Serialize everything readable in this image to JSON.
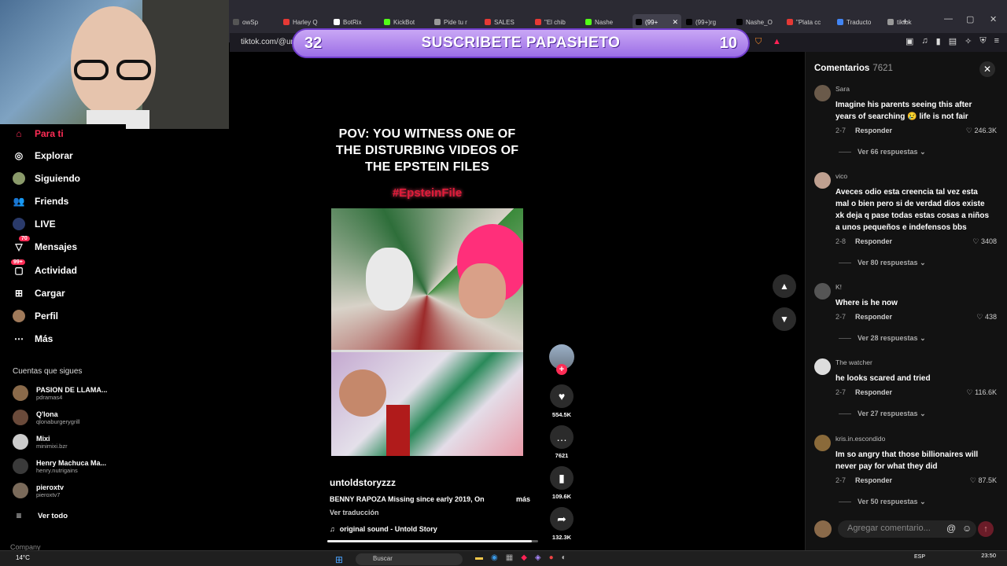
{
  "browser": {
    "tabs": [
      {
        "label": "owSp",
        "color": "#555"
      },
      {
        "label": "Harley Q",
        "color": "#e53935"
      },
      {
        "label": "BotRix",
        "color": "#ffffff"
      },
      {
        "label": "KickBot",
        "color": "#53fc18"
      },
      {
        "label": "Pide tu r",
        "color": "#999"
      },
      {
        "label": "SALES",
        "color": "#e53935"
      },
      {
        "label": "\"El chib",
        "color": "#e53935"
      },
      {
        "label": "Nashe",
        "color": "#53fc18"
      },
      {
        "label": "(99+",
        "color": "#000"
      },
      {
        "label": "(99+)rg",
        "color": "#000"
      },
      {
        "label": "Nashe_O",
        "color": "#000"
      },
      {
        "label": "\"Plata cc",
        "color": "#e53935"
      },
      {
        "label": "Traducto",
        "color": "#4285f4"
      },
      {
        "label": "tiktok",
        "color": "#999"
      }
    ],
    "active_tab_index": 8,
    "url": "tiktok.com/@ur"
  },
  "banner": {
    "left_number": "32",
    "text": "SUSCRIBETE PAPASHETO",
    "right_number": "10"
  },
  "leftnav": {
    "items": [
      {
        "label": "Para ti",
        "icon": "home-icon",
        "active": true
      },
      {
        "label": "Explorar",
        "icon": "compass-icon"
      },
      {
        "label": "Siguiendo",
        "icon": "following-avatar-icon"
      },
      {
        "label": "Friends",
        "icon": "friends-icon"
      },
      {
        "label": "LIVE",
        "icon": "live-icon"
      },
      {
        "label": "Mensajes",
        "icon": "messages-icon",
        "badge": "70"
      },
      {
        "label": "Actividad",
        "icon": "activity-icon",
        "badge": "99+"
      },
      {
        "label": "Cargar",
        "icon": "upload-icon"
      },
      {
        "label": "Perfil",
        "icon": "profile-icon"
      },
      {
        "label": "Más",
        "icon": "more-icon"
      }
    ],
    "following_title": "Cuentas que sigues",
    "following": [
      {
        "name": "PASION DE LLAMA...",
        "handle": "pdramas4"
      },
      {
        "name": "Q'lona",
        "handle": "qlonaburgerygrill"
      },
      {
        "name": "Mixi",
        "handle": "minimixi.bzr"
      },
      {
        "name": "Henry Machuca Ma...",
        "handle": "henry.nutrigains"
      },
      {
        "name": "pieroxtv",
        "handle": "pieroxtv7"
      }
    ],
    "see_all": "Ver todo",
    "company": "Company"
  },
  "video": {
    "title": "POV: YOU WITNESS ONE OF THE DISTURBING VIDEOS OF THE EPSTEIN FILES",
    "hashtag": "#EpsteinFile",
    "username": "untoldstoryzzz",
    "description": "BENNY RAPOZA Missing since early 2019, On",
    "more": "más",
    "translate": "Ver traducción",
    "sound": "original sound - Untold Story",
    "progress": 0.97
  },
  "actions": {
    "likes": "554.5K",
    "comments": "7621",
    "saves": "109.6K",
    "shares": "132.3K"
  },
  "comments": {
    "header": "Comentarios",
    "count": "7621",
    "items": [
      {
        "user": "Sara",
        "text": "Imagine his parents seeing this after years of searching 😢 life is not fair",
        "date": "2-7",
        "reply": "Responder",
        "likes": "246.3K",
        "more": "Ver 66 respuestas"
      },
      {
        "user": "vico",
        "text": "Aveces odio esta creencia tal vez esta mal o bien pero si de verdad dios existe xk deja q pase todas estas cosas a niños a unos pequeños e indefensos bbs",
        "date": "2-8",
        "reply": "Responder",
        "likes": "3408",
        "more": "Ver 80 respuestas"
      },
      {
        "user": "K!",
        "text": "Where is he now",
        "date": "2-7",
        "reply": "Responder",
        "likes": "438",
        "more": "Ver 28 respuestas"
      },
      {
        "user": "The watcher",
        "text": "he looks scared and tried",
        "date": "2-7",
        "reply": "Responder",
        "likes": "116.6K",
        "more": "Ver 27 respuestas"
      },
      {
        "user": "kris.in.escondido",
        "text": "Im so angry that those billionaires will never pay for what they did",
        "date": "2-7",
        "reply": "Responder",
        "likes": "87.5K",
        "more": "Ver 50 respuestas"
      }
    ],
    "input_placeholder": "Agregar comentario..."
  },
  "taskbar": {
    "weather": "14°C",
    "search": "Buscar",
    "lang": "ESP",
    "time": "23:50"
  }
}
